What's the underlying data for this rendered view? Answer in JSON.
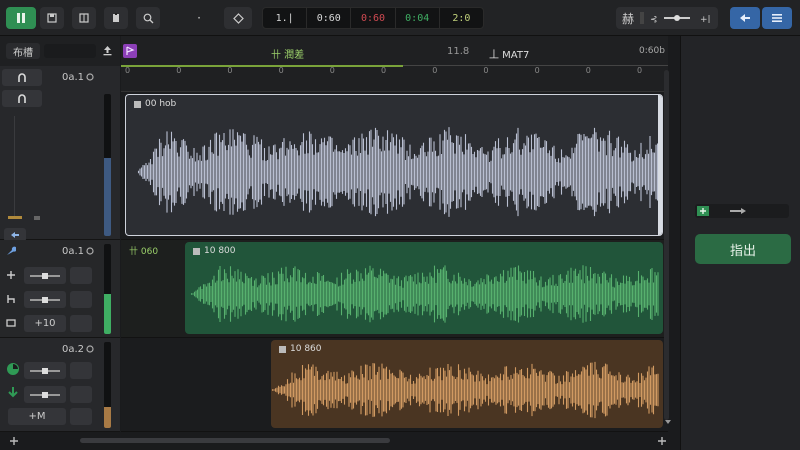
{
  "toolbar": {
    "play_icon": "pause-icon",
    "counter": [
      "1.|",
      "0:60",
      "0:60",
      "0:04",
      "2:0"
    ],
    "counter_colors": [
      "#d8d8d8",
      "#d8d8d8",
      "#d04a52",
      "#3fae63",
      "#bfcf7a"
    ],
    "right_label": "赫",
    "colors": {
      "accent_green": "#2f8f53",
      "accent_blue": "#3566a6"
    }
  },
  "left_panel": {
    "header_label": "布槽",
    "tracks": [
      {
        "label": "0a.1",
        "meter_level": 0.55,
        "meter_color": "#3e5a82"
      },
      {
        "label": "0a.1",
        "meter_level": 0.45,
        "meter_color": "#3fae63",
        "button": "+10"
      },
      {
        "label": "0a.2",
        "meter_level": 0.25,
        "meter_color": "#a87a45",
        "button": "+M"
      }
    ]
  },
  "ruler": {
    "marker_left": "卄 潤差",
    "marker_mid": "11.8",
    "marker_right": "丄 MAT7",
    "marker_end": "0:60b",
    "ticks": [
      "0",
      "0",
      "0",
      "0",
      "0",
      "0",
      "0",
      "0",
      "0",
      "0",
      "0"
    ]
  },
  "clips": [
    {
      "label": "00 hob",
      "color": "#2c2e33",
      "wave": "#b9bfd1"
    },
    {
      "label": "10 800",
      "color": "#21553a",
      "wave": "#57b06e"
    },
    {
      "label": "10 860",
      "color": "#4a3522",
      "wave": "#d19a62"
    }
  ],
  "lane2_prefix": "卄 060",
  "right_panel": {
    "export_label": "指出"
  }
}
